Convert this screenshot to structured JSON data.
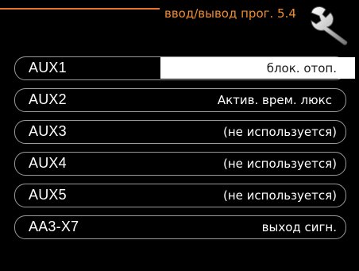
{
  "header": {
    "title": "ввод/вывод прог. 5.4",
    "icon": "wrench-icon",
    "accent_color": "#f08c30"
  },
  "menu": {
    "rows": [
      {
        "label": "AUX1",
        "value": "блок. отоп.",
        "selected": true
      },
      {
        "label": "AUX2",
        "value": "Актив. врем. люкс",
        "selected": false
      },
      {
        "label": "AUX3",
        "value": "(не используется)",
        "selected": false
      },
      {
        "label": "AUX4",
        "value": "(не используется)",
        "selected": false
      },
      {
        "label": "AUX5",
        "value": "(не используется)",
        "selected": false
      },
      {
        "label": "AA3-X7",
        "value": "выход сигн.",
        "selected": false
      }
    ]
  }
}
